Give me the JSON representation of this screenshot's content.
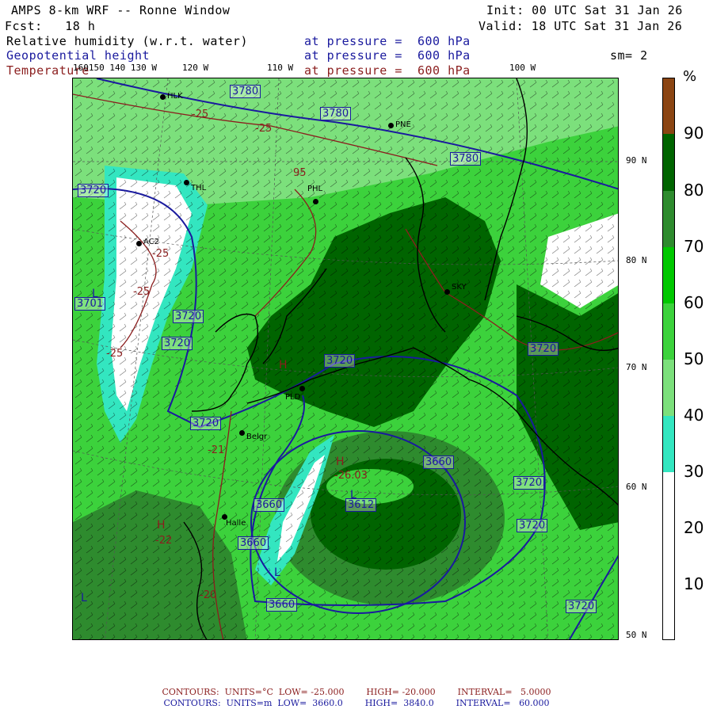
{
  "header": {
    "title": "AMPS 8-km WRF -- Ronne Window",
    "init": "Init: 00 UTC Sat 31 Jan 26",
    "fcst": "Fcst:   18 h",
    "valid": "Valid: 18 UTC Sat 31 Jan 26",
    "field1": "Relative humidity (w.r.t. water)",
    "field2": "Geopotential height",
    "field3": "Temperature",
    "pressure1": "at pressure =  600 hPa",
    "pressure2": "at pressure =  600 hPa",
    "pressure3": "at pressure =  600 hPa",
    "smoothing": "sm= 2"
  },
  "axis_labels": {
    "top": [
      "160150 140 130 W",
      "120 W",
      "110 W",
      "100 W"
    ],
    "right": [
      "90 N",
      "80 N",
      "70 N",
      "60 N",
      "50 N"
    ]
  },
  "colorbar": {
    "unit": "%",
    "ticks": [
      "90",
      "80",
      "70",
      "60",
      "50",
      "40",
      "30",
      "20",
      "10"
    ],
    "colors": [
      "#8b4513",
      "#006400",
      "#2e8b2e",
      "#00c800",
      "#3cd23c",
      "#7ce07c",
      "#33e6c0",
      "#ffffff",
      "#ffffff"
    ]
  },
  "stations": [
    "HLK",
    "PNE",
    "THL",
    "AC2",
    "PHL",
    "SKY",
    "PLD",
    "Belgr",
    "Halle"
  ],
  "height_labels": [
    "3780",
    "3780",
    "3780",
    "3720",
    "3720",
    "3720",
    "3720",
    "3720",
    "3720",
    "3701",
    "3660",
    "3660",
    "3660",
    "3660",
    "3720",
    "3720",
    "3612",
    "3720"
  ],
  "temp_labels": [
    "-25",
    "-25",
    "-25",
    "-25",
    "-25",
    "95",
    "-21",
    "-22",
    "-26.03",
    "-20"
  ],
  "hl_marks": [
    "L",
    "L",
    "H",
    "H",
    "L",
    "H",
    "L"
  ],
  "footer": {
    "line1": "CONTOURS:  UNITS=°C  LOW= -25.000        HIGH= -20.000        INTERVAL=   5.0000",
    "line2": "CONTOURS:  UNITS=m  LOW=  3660.0        HIGH=  3840.0        INTERVAL=   60.000"
  },
  "colors": {
    "rh_white": "#ffffff",
    "rh_cyan": "#33e6c0",
    "rh_light": "#7ce07c",
    "rh_mid": "#3cd23c",
    "rh_green": "#00c800",
    "rh_dark": "#2e8b2e",
    "rh_darkest": "#006400",
    "height_contour": "#1a1a9e",
    "temp_contour": "#8b1e1e",
    "coast": "#000000"
  }
}
